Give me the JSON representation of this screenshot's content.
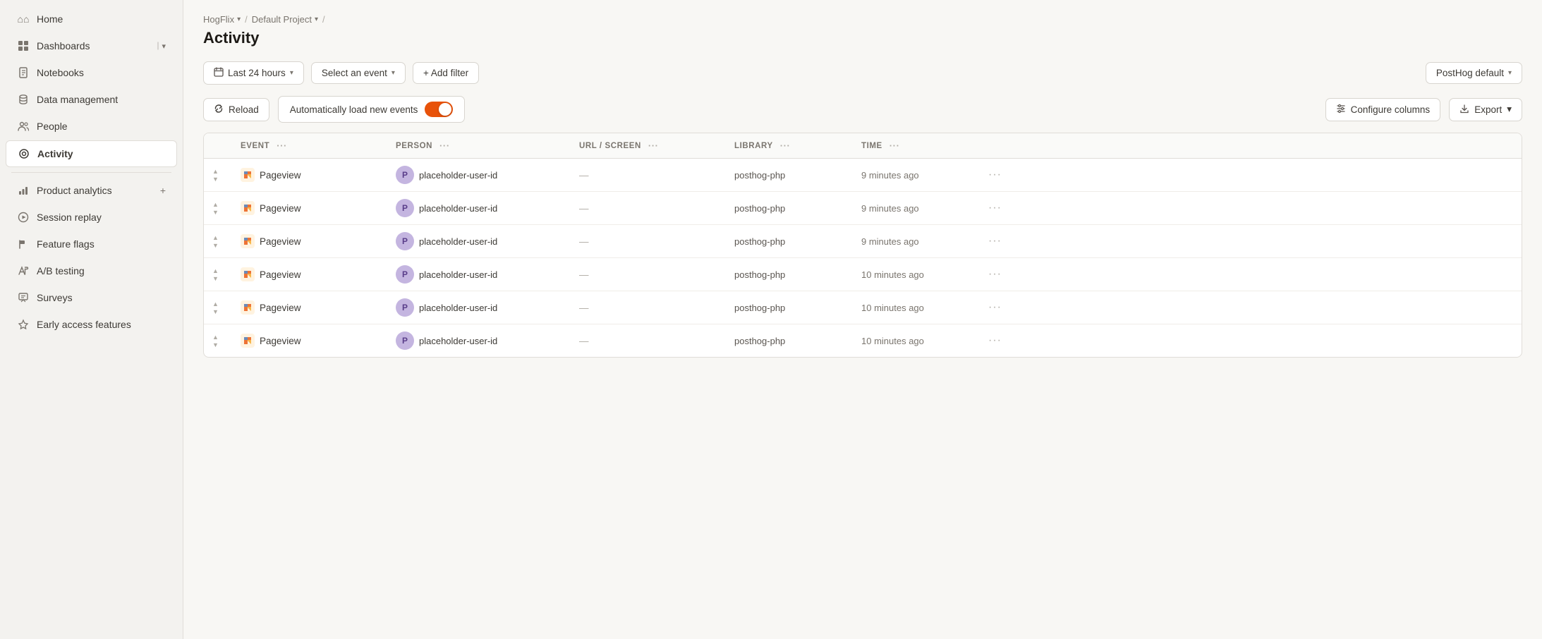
{
  "breadcrumb": {
    "project": "HogFlix",
    "sub": "Default Project",
    "sep": "/"
  },
  "page": {
    "title": "Activity"
  },
  "toolbar": {
    "time_filter_label": "Last 24 hours",
    "event_filter_label": "Select an event",
    "add_filter_label": "+ Add filter",
    "cluster_label": "PostHog default",
    "reload_label": "Reload",
    "auto_load_label": "Automatically load new events",
    "configure_columns_label": "Configure columns",
    "export_label": "Export"
  },
  "table": {
    "columns": [
      {
        "key": "event",
        "label": "EVENT"
      },
      {
        "key": "person",
        "label": "PERSON"
      },
      {
        "key": "url",
        "label": "URL / SCREEN"
      },
      {
        "key": "library",
        "label": "LIBRARY"
      },
      {
        "key": "time",
        "label": "TIME"
      }
    ],
    "rows": [
      {
        "event": "Pageview",
        "person": "placeholder-user-id",
        "url": "—",
        "library": "posthog-php",
        "time": "9 minutes ago"
      },
      {
        "event": "Pageview",
        "person": "placeholder-user-id",
        "url": "—",
        "library": "posthog-php",
        "time": "9 minutes ago"
      },
      {
        "event": "Pageview",
        "person": "placeholder-user-id",
        "url": "—",
        "library": "posthog-php",
        "time": "9 minutes ago"
      },
      {
        "event": "Pageview",
        "person": "placeholder-user-id",
        "url": "—",
        "library": "posthog-php",
        "time": "10 minutes ago"
      },
      {
        "event": "Pageview",
        "person": "placeholder-user-id",
        "url": "—",
        "library": "posthog-php",
        "time": "10 minutes ago"
      },
      {
        "event": "Pageview",
        "person": "placeholder-user-id",
        "url": "—",
        "library": "posthog-php",
        "time": "10 minutes ago"
      }
    ]
  },
  "sidebar": {
    "items": [
      {
        "id": "home",
        "label": "Home",
        "icon": "home"
      },
      {
        "id": "dashboards",
        "label": "Dashboards",
        "icon": "dashboard",
        "chevron": true
      },
      {
        "id": "notebooks",
        "label": "Notebooks",
        "icon": "notebook"
      },
      {
        "id": "data-management",
        "label": "Data management",
        "icon": "data"
      },
      {
        "id": "people",
        "label": "People",
        "icon": "people"
      },
      {
        "id": "activity",
        "label": "Activity",
        "icon": "activity",
        "active": true
      },
      {
        "id": "product-analytics",
        "label": "Product analytics",
        "icon": "analytics",
        "plus": true
      },
      {
        "id": "session-replay",
        "label": "Session replay",
        "icon": "session"
      },
      {
        "id": "feature-flags",
        "label": "Feature flags",
        "icon": "flag"
      },
      {
        "id": "ab-testing",
        "label": "A/B testing",
        "icon": "ab"
      },
      {
        "id": "surveys",
        "label": "Surveys",
        "icon": "survey"
      },
      {
        "id": "early-access",
        "label": "Early access features",
        "icon": "early"
      }
    ]
  }
}
